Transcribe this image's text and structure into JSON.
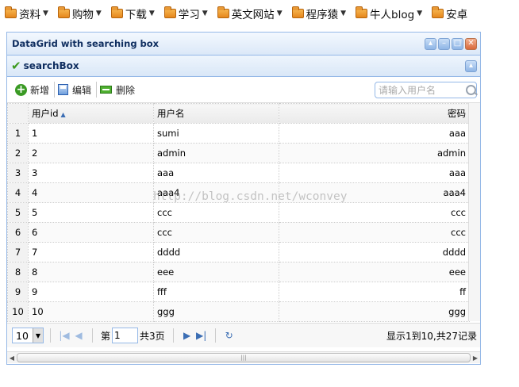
{
  "bookmarks": [
    {
      "label": "资料"
    },
    {
      "label": "购物"
    },
    {
      "label": "下载"
    },
    {
      "label": "学习"
    },
    {
      "label": "英文网站"
    },
    {
      "label": "程序猿"
    },
    {
      "label": "牛人blog"
    },
    {
      "label": "安卓"
    }
  ],
  "panel": {
    "title": "DataGrid with searching box",
    "tools": {
      "collapse": "collapse-icon",
      "minimize": "minimize-icon",
      "maximize": "maximize-icon",
      "close": "close-icon"
    }
  },
  "searchbox_panel": {
    "title": "searchBox"
  },
  "toolbar": {
    "add_label": "新增",
    "edit_label": "编辑",
    "delete_label": "删除",
    "search_placeholder": "请输入用户名"
  },
  "grid": {
    "columns": {
      "user_id": "用户id",
      "username": "用户名",
      "password": "密码"
    },
    "rows": [
      {
        "num": "1",
        "id": "1",
        "name": "sumi",
        "pwd": "aaa"
      },
      {
        "num": "2",
        "id": "2",
        "name": "admin",
        "pwd": "admin"
      },
      {
        "num": "3",
        "id": "3",
        "name": "aaa",
        "pwd": "aaa"
      },
      {
        "num": "4",
        "id": "4",
        "name": "aaa4",
        "pwd": "aaa4"
      },
      {
        "num": "5",
        "id": "5",
        "name": "ccc",
        "pwd": "ccc"
      },
      {
        "num": "6",
        "id": "6",
        "name": "ccc",
        "pwd": "ccc"
      },
      {
        "num": "7",
        "id": "7",
        "name": "dddd",
        "pwd": "dddd"
      },
      {
        "num": "8",
        "id": "8",
        "name": "eee",
        "pwd": "eee"
      },
      {
        "num": "9",
        "id": "9",
        "name": "fff",
        "pwd": "ff"
      },
      {
        "num": "10",
        "id": "10",
        "name": "ggg",
        "pwd": "ggg"
      }
    ],
    "watermark": "http://blog.csdn.net/wconvey"
  },
  "pager": {
    "page_size": "10",
    "page_prefix": "第",
    "page_number": "1",
    "page_suffix": "共3页",
    "info": "显示1到10,共27记录"
  },
  "colors": {
    "accent": "#95b8e7",
    "header_text": "#0e2d5f"
  }
}
